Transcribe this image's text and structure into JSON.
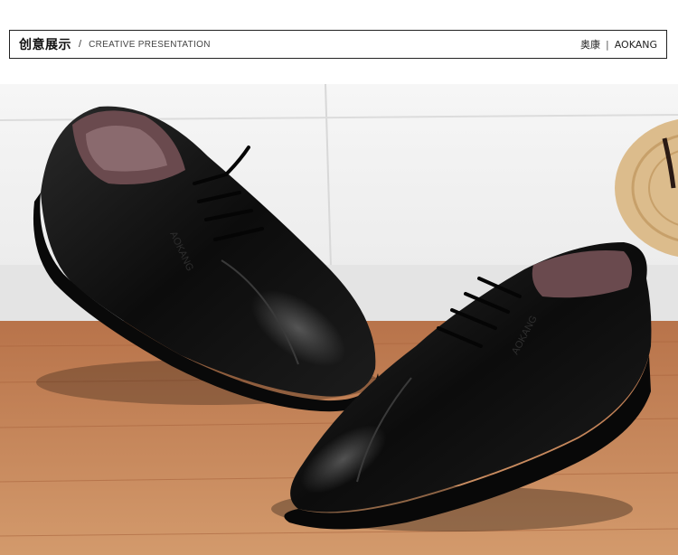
{
  "header": {
    "title_cn": "创意展示",
    "separator": "/",
    "title_en": "CREATIVE PRESENTATION",
    "brand_cn": "奥康",
    "brand_divider": "|",
    "brand_en": "AOKANG"
  },
  "photo": {
    "subject": "shoe-product-photo",
    "shoe_logo_text": "AOKANG",
    "colors": {
      "wall": "#f1f1f1",
      "floor": "#c07a4a",
      "shoe": "#141414",
      "lining": "#6a4a4e"
    }
  }
}
